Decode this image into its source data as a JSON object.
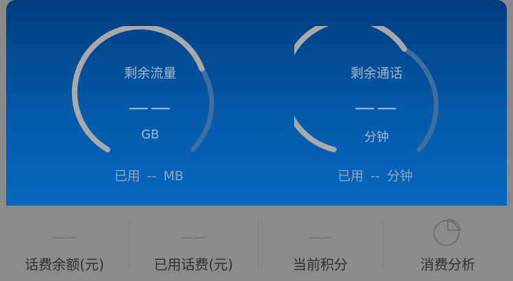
{
  "gauges": {
    "data": {
      "title": "剩余流量",
      "value": "——",
      "unit": "GB",
      "used_prefix": "已用",
      "used_value": "--",
      "used_unit": "MB"
    },
    "voice": {
      "title": "剩余通话",
      "value": "——",
      "unit": "分钟",
      "used_prefix": "已用",
      "used_value": "--",
      "used_unit": "分钟"
    }
  },
  "tiles": [
    {
      "value": "——",
      "label": "话费余额(元)"
    },
    {
      "value": "——",
      "label": "已用话费(元)"
    },
    {
      "value": "——",
      "label": "当前积分"
    },
    {
      "label": "消费分析",
      "icon": "pie-chart-icon"
    }
  ],
  "colors": {
    "hero_top": "#003d7e",
    "hero_bottom": "#0667bd",
    "arc_active": "#a9a9a9",
    "arc_track": "#3d6e9e",
    "overlay_gray": "#8a8a8a"
  }
}
